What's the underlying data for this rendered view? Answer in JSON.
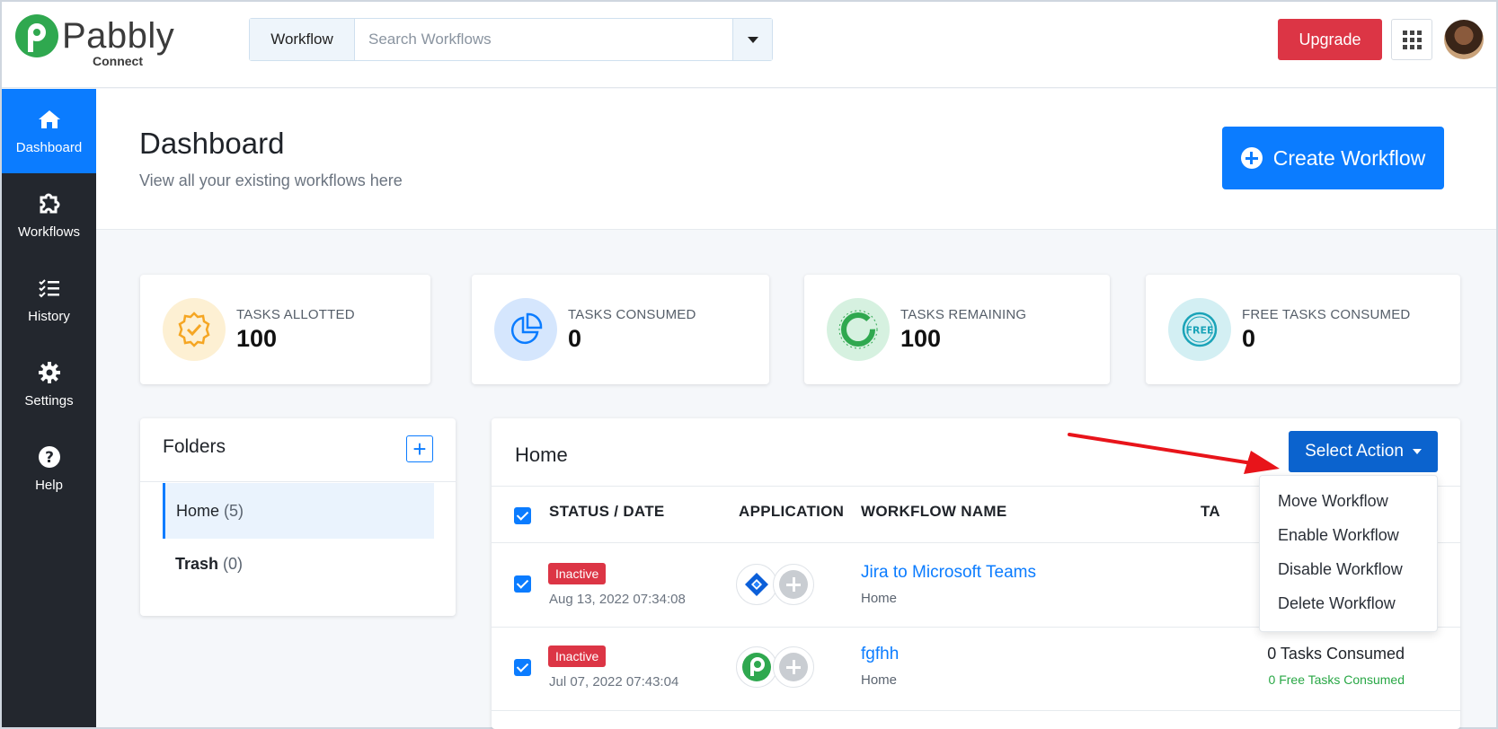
{
  "brand": {
    "name": "Pabbly",
    "sub": "Connect",
    "color": "#2fa84f"
  },
  "search": {
    "prefix": "Workflow",
    "placeholder": "Search Workflows"
  },
  "topbar": {
    "upgrade_label": "Upgrade",
    "apps_icon": "grid-icon"
  },
  "sidebar": {
    "items": [
      {
        "label": "Dashboard",
        "icon": "home-icon",
        "active": true
      },
      {
        "label": "Workflows",
        "icon": "puzzle-icon",
        "active": false
      },
      {
        "label": "History",
        "icon": "list-check-icon",
        "active": false
      },
      {
        "label": "Settings",
        "icon": "gear-icon",
        "active": false
      },
      {
        "label": "Help",
        "icon": "question-icon",
        "active": false
      }
    ]
  },
  "header": {
    "title": "Dashboard",
    "subtitle": "View all your existing workflows here",
    "create_label": "Create Workflow"
  },
  "stats": [
    {
      "label": "TASKS ALLOTTED",
      "value": "100",
      "icon": "badge-check-icon",
      "color": "#f5a623"
    },
    {
      "label": "TASKS CONSUMED",
      "value": "0",
      "icon": "pie-chart-icon",
      "color": "#0b7cff"
    },
    {
      "label": "TASKS REMAINING",
      "value": "100",
      "icon": "ring-icon",
      "color": "#2fa84f"
    },
    {
      "label": "FREE TASKS CONSUMED",
      "value": "0",
      "icon": "free-icon",
      "color": "#1aa3b8"
    }
  ],
  "folders": {
    "title": "Folders",
    "items": [
      {
        "name": "Home",
        "count": "(5)"
      },
      {
        "name": "Trash",
        "count": "(0)"
      }
    ]
  },
  "workflows": {
    "title": "Home",
    "select_action_label": "Select Action",
    "columns": {
      "status": "STATUS / DATE",
      "application": "APPLICATION",
      "name": "WORKFLOW NAME",
      "tasks": "TA"
    },
    "rows": [
      {
        "status": "Inactive",
        "date": "Aug 13, 2022 07:34:08",
        "app": "jira-icon",
        "name": "Jira to Microsoft Teams",
        "folder": "Home",
        "tasks": "",
        "free_tasks": ""
      },
      {
        "status": "Inactive",
        "date": "Jul 07, 2022 07:43:04",
        "app": "pabbly-icon",
        "name": "fgfhh",
        "folder": "Home",
        "tasks": "0 Tasks Consumed",
        "free_tasks": "0 Free Tasks Consumed"
      }
    ],
    "menu": [
      "Move Workflow",
      "Enable Workflow",
      "Disable Workflow",
      "Delete Workflow"
    ]
  }
}
